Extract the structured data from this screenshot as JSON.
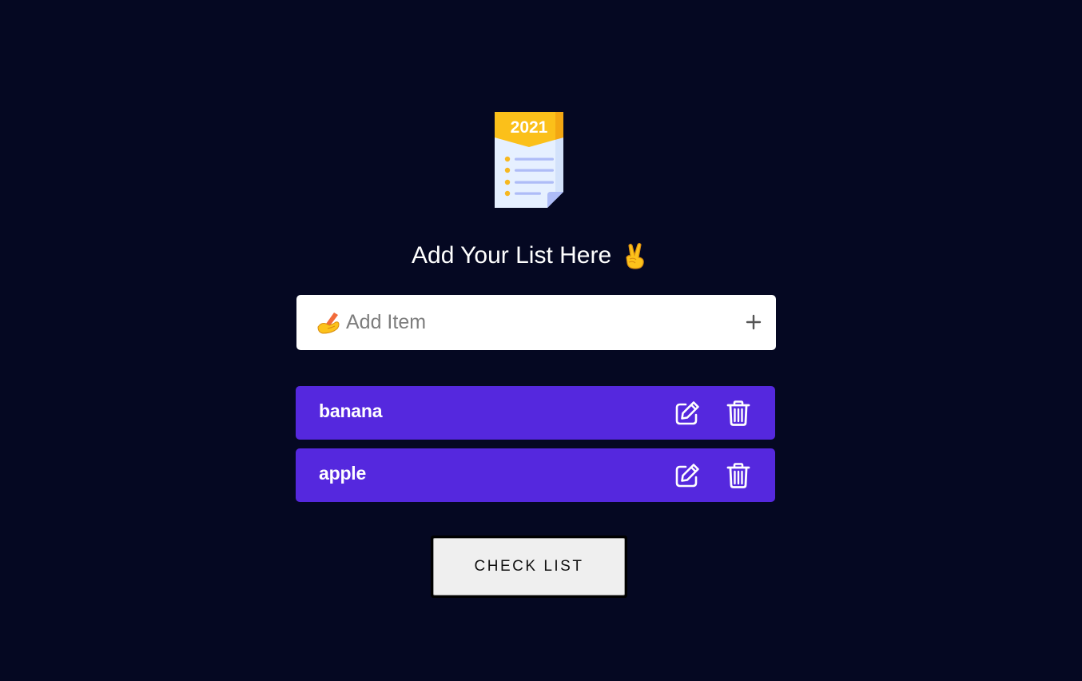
{
  "logo": {
    "year": "2021",
    "icon": "checklist-document-icon",
    "colors": {
      "banner": "#fbc01a",
      "paper": "#e6f0ff",
      "lines": "#aebcf7",
      "bullets": "#f6b820"
    }
  },
  "heading": {
    "text": "Add Your List Here",
    "emoji": "victory-hand-emoji-icon"
  },
  "add_item": {
    "emoji": "writing-hand-emoji-icon",
    "placeholder": "Add Item",
    "value": "",
    "add_icon": "plus-icon"
  },
  "items": [
    {
      "label": "banana",
      "edit_icon": "edit-icon",
      "delete_icon": "trash-icon"
    },
    {
      "label": "apple",
      "edit_icon": "edit-icon",
      "delete_icon": "trash-icon"
    }
  ],
  "check_button": {
    "label": "CHECK LIST"
  },
  "colors": {
    "background": "#050822",
    "item_background": "#5528de",
    "input_background": "#ffffff",
    "button_background": "#efefef"
  }
}
